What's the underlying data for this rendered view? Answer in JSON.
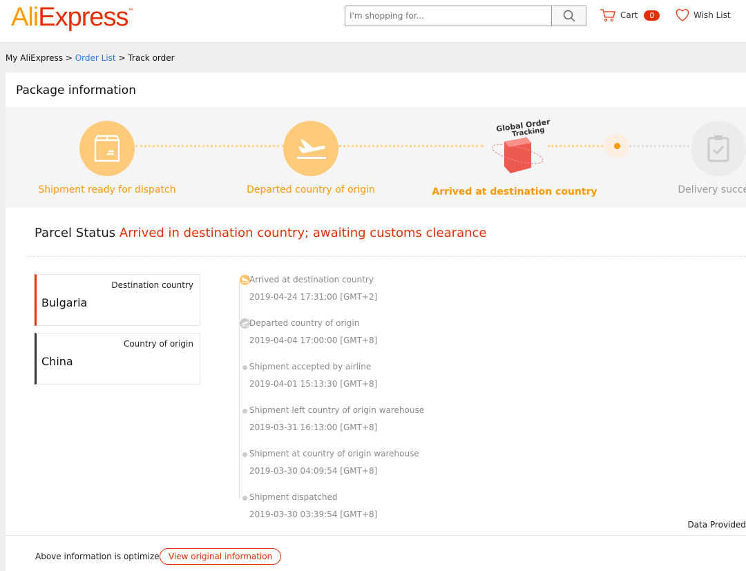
{
  "header": {
    "logo": "AliExpress",
    "logo_tm": "™",
    "search_placeholder": "I'm shopping for...",
    "cart_label": "Cart",
    "cart_count": "0",
    "wishlist_label": "Wish List"
  },
  "breadcrumb": {
    "items": [
      "My AliExpress",
      "Order List",
      "Track order"
    ],
    "separator": ">"
  },
  "package": {
    "title": "Package information",
    "steps": [
      {
        "label": "Shipment ready for dispatch",
        "icon": "box-icon",
        "state": "done"
      },
      {
        "label": "Departed country of origin",
        "icon": "plane-departure-icon",
        "state": "done"
      },
      {
        "label": "Arrived at destination country",
        "icon": "global-order-tracking-cube-icon",
        "state": "current",
        "badge": "Global Order Tracking"
      },
      {
        "label": "Delivery success",
        "icon": "clipboard-check-icon",
        "state": "pending"
      }
    ]
  },
  "parcel": {
    "label": "Parcel Status",
    "status": "Arrived in destination country; awaiting customs clearance"
  },
  "countries": [
    {
      "label": "Destination country",
      "value": "Bulgaria"
    },
    {
      "label": "Country of origin",
      "value": "China"
    }
  ],
  "events": [
    {
      "title": "Arrived at destination country",
      "time": "2019-04-24 17:31:00 [GMT+2]"
    },
    {
      "title": "Departed country of origin",
      "time": "2019-04-04 17:00:00 [GMT+8]"
    },
    {
      "title": "Shipment accepted by airline",
      "time": "2019-04-01 15:13:30 [GMT+8]"
    },
    {
      "title": "Shipment left country of origin warehouse",
      "time": "2019-03-31 16:13:00 [GMT+8]"
    },
    {
      "title": "Shipment at country of origin warehouse",
      "time": "2019-03-30 04:09:54 [GMT+8]"
    },
    {
      "title": "Shipment dispatched",
      "time": "2019-03-30 03:39:54 [GMT+8]"
    }
  ],
  "footer": {
    "data_provided": "Data Provided",
    "optimized": "Above information is optimized",
    "view_original": "View original information"
  },
  "colors": {
    "brand": "#e62e04",
    "orange": "#ff9a00",
    "step_fill": "#ffcb7a"
  }
}
